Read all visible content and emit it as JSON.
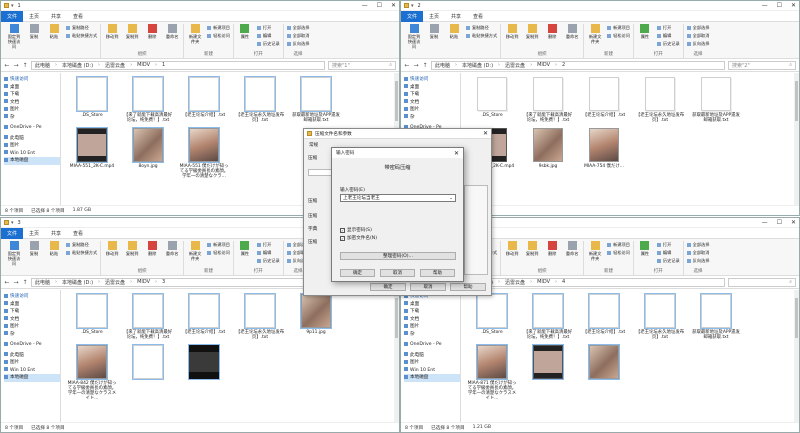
{
  "ribbon": {
    "tab_file": "文件",
    "tab_home": "主页",
    "tab_share": "共享",
    "tab_view": "查看",
    "pin_quick": "固定到快速访问",
    "copy": "复制",
    "paste": "粘贴",
    "copy_path": "复制路径",
    "paste_shortcut": "粘贴快捷方式",
    "move_to": "移动到",
    "copy_to": "复制到",
    "delete": "删除",
    "rename": "重命名",
    "new_folder": "新建文件夹",
    "new_item": "新建项目",
    "easy_access": "轻松访问",
    "properties": "属性",
    "open": "打开",
    "edit": "编辑",
    "history": "历史记录",
    "select_all": "全部选择",
    "select_none": "全部取消",
    "invert_select": "反向选择",
    "grp_organize": "组织",
    "grp_new": "新建",
    "grp_open": "打开",
    "grp_select": "选择"
  },
  "nav": {
    "quick_access": "快速访问",
    "desktop": "桌面",
    "downloads": "下载",
    "documents": "文档",
    "pictures": "图片",
    "misc": "杂",
    "onedrive": "OneDrive - Pe",
    "this_pc": "此电脑",
    "net_pictures": "图片",
    "win10": "Win 10 Ent",
    "local_disk": "本地磁盘"
  },
  "windows": [
    {
      "title": "1",
      "path": [
        "此电脑",
        "本地磁盘 (D:)",
        "迅雷云盘",
        "MIDV",
        "1"
      ],
      "search": "搜索\"1\"",
      "status_count": "8 个项目",
      "status_sel": "已选择 8 个项目",
      "status_size": "1.87 GB",
      "files": [
        {
          "name": ".DS_Store",
          "kind": "doc"
        },
        {
          "name": "【来了就能下载高清最好论坛，纯免费！】.txt",
          "kind": "doc"
        },
        {
          "name": "【老王论坛介绍】.txt",
          "kind": "doc"
        },
        {
          "name": "【老王论坛永久地址发布页】.txt",
          "kind": "doc"
        },
        {
          "name": "获取最新地址及APP遗发邮箱获取.txt",
          "kind": "doc"
        },
        {
          "name": "MIAA-551_2K-C.mp4",
          "kind": "vid"
        },
        {
          "name": "8oyn.jpg",
          "kind": "img"
        },
        {
          "name": "MIAA-551 僕だけが知ってる学級委員長の素顔。学年一の清楚なクラ...",
          "kind": "img2"
        }
      ]
    },
    {
      "title": "2",
      "path": [
        "此电脑",
        "本地磁盘 (D:)",
        "迅雷云盘",
        "MIDV",
        "2"
      ],
      "search": "搜索\"2\"",
      "status_count": "8 个项目",
      "status_sel": "",
      "status_size": "",
      "files": [
        {
          "name": ".DS_Store",
          "kind": "doc"
        },
        {
          "name": "【来了就能下载高清最好论坛，纯免费！】.txt",
          "kind": "doc"
        },
        {
          "name": "【老王论坛介绍】.txt",
          "kind": "doc"
        },
        {
          "name": "【老王论坛永久地址发布页】.txt",
          "kind": "doc"
        },
        {
          "name": "获取最新地址及APP遗发邮箱获取.txt",
          "kind": "doc"
        },
        {
          "name": "MIAA-754_2K-C.mp4",
          "kind": "vid"
        },
        {
          "name": "9sbk.jpg",
          "kind": "img"
        },
        {
          "name": "MIAA-754 僕だけ...",
          "kind": "img2"
        }
      ]
    },
    {
      "title": "3",
      "path": [
        "此电脑",
        "本地磁盘 (D:)",
        "迅雷云盘",
        "MIDV",
        "3"
      ],
      "search": "",
      "status_count": "8 个项目",
      "status_sel": "已选择 8 个项目",
      "status_size": "",
      "files": [
        {
          "name": ".DS_Store",
          "kind": "doc"
        },
        {
          "name": "【来了就能下载高清最好论坛，纯免费！】.txt",
          "kind": "doc"
        },
        {
          "name": "【老王论坛介绍】.txt",
          "kind": "doc"
        },
        {
          "name": "【老王论坛永久地址发布页】.txt",
          "kind": "doc"
        },
        {
          "name": "9p11.jpg",
          "kind": "img"
        },
        {
          "name": "MIAA-842 僕だけが知ってる学級委員長の素顔。学年一の清楚なクラスメイト...",
          "kind": "img2"
        },
        {
          "name": "",
          "kind": "doc"
        },
        {
          "name": "",
          "kind": "dark"
        }
      ]
    },
    {
      "title": "4",
      "path": [
        "此电脑",
        "本地磁盘 (D:)",
        "迅雷云盘",
        "MIDV",
        "4"
      ],
      "search": "",
      "status_count": "8 个项目",
      "status_sel": "已选择 8 个项目",
      "status_size": "1.21 GB",
      "files": [
        {
          "name": ".DS_Store",
          "kind": "doc"
        },
        {
          "name": "【来了就能下载高清最好论坛，纯免费！】.txt",
          "kind": "doc"
        },
        {
          "name": "【老王论坛介绍】.txt",
          "kind": "doc"
        },
        {
          "name": "【老王论坛永久地址发布页】.txt",
          "kind": "doc"
        },
        {
          "name": "获取最新地址及APP遗发邮箱获取.txt",
          "kind": "doc"
        },
        {
          "name": "MIAA-871 僕だけが知ってる学級委員長の素顔。学年一の清楚なクラスメイト...",
          "kind": "img2"
        },
        {
          "name": "",
          "kind": "vid"
        },
        {
          "name": "",
          "kind": "img"
        }
      ]
    }
  ],
  "archive_dialog": {
    "title": "压缩文件名和参数",
    "tab_general": "常规",
    "label_archive": "压缩",
    "label_update": "压缩",
    "label_archive_opts": "压缩",
    "label_dict": "字典",
    "label_split": "压缩",
    "ok": "确定",
    "cancel": "取消",
    "help": "帮助"
  },
  "password_dialog": {
    "title": "输入密码",
    "heading": "带密码压缩",
    "pw_label": "输入密码(E)",
    "pw_value": "上老王论坛当老王",
    "show_pw": "显示密码(S)",
    "encrypt_names": "加密文件名(N)",
    "organize": "整理密码(O)...",
    "ok": "确定",
    "cancel": "取消",
    "help": "帮助"
  }
}
